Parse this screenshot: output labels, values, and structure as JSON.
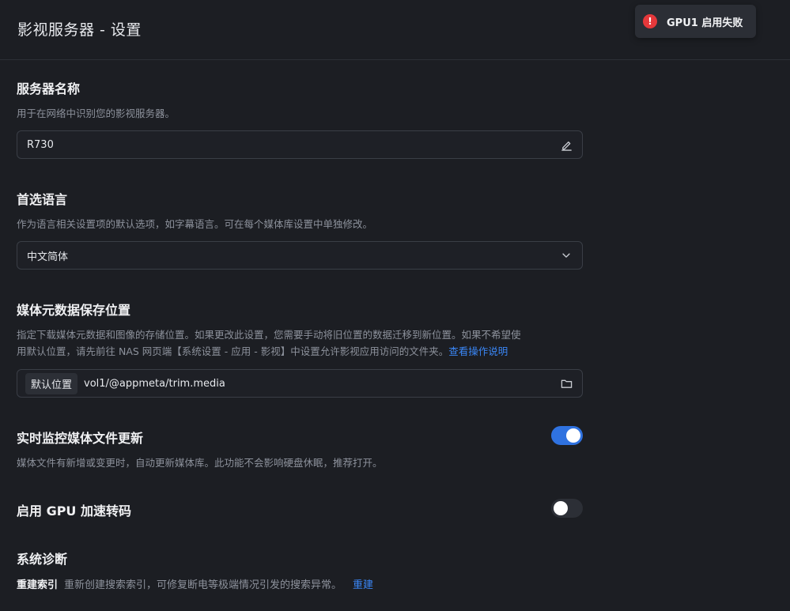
{
  "page": {
    "title": "影视服务器 - 设置"
  },
  "toast": {
    "icon": "error-icon",
    "icon_glyph": "!",
    "message": "GPU1 启用失败"
  },
  "server_name": {
    "title": "服务器名称",
    "description": "用于在网络中识别您的影视服务器。",
    "value": "R730",
    "icon": "edit-icon"
  },
  "language": {
    "title": "首选语言",
    "description": "作为语言相关设置项的默认选项，如字幕语言。可在每个媒体库设置中单独修改。",
    "selected": "中文简体",
    "icon": "chevron-down-icon"
  },
  "metadata_location": {
    "title": "媒体元数据保存位置",
    "description_line1": "指定下载媒体元数据和图像的存储位置。如果更改此设置，您需要手动将旧位置的数据迁移到新位置。如果不希望使",
    "description_line2": "用默认位置，请先前往 NAS 网页端【系统设置 - 应用 - 影视】中设置允许影视应用访问的文件夹。",
    "help_link": "查看操作说明",
    "tag": "默认位置",
    "path": "vol1/@appmeta/trim.media",
    "icon": "folder-icon"
  },
  "realtime_monitor": {
    "title": "实时监控媒体文件更新",
    "description": "媒体文件有新增或变更时，自动更新媒体库。此功能不会影响硬盘休眠，推荐打开。",
    "enabled": true
  },
  "gpu_transcode": {
    "title": "启用 GPU 加速转码",
    "enabled": false
  },
  "diagnostics": {
    "title": "系统诊断",
    "rebuild_label": "重建索引",
    "rebuild_desc": "重新创建搜索索引，可修复断电等极端情况引发的搜索异常。",
    "rebuild_link": "重建"
  },
  "colors": {
    "background": "#1c1e23",
    "accent": "#2f72e0",
    "link": "#3a86f5",
    "error": "#e5383b"
  }
}
